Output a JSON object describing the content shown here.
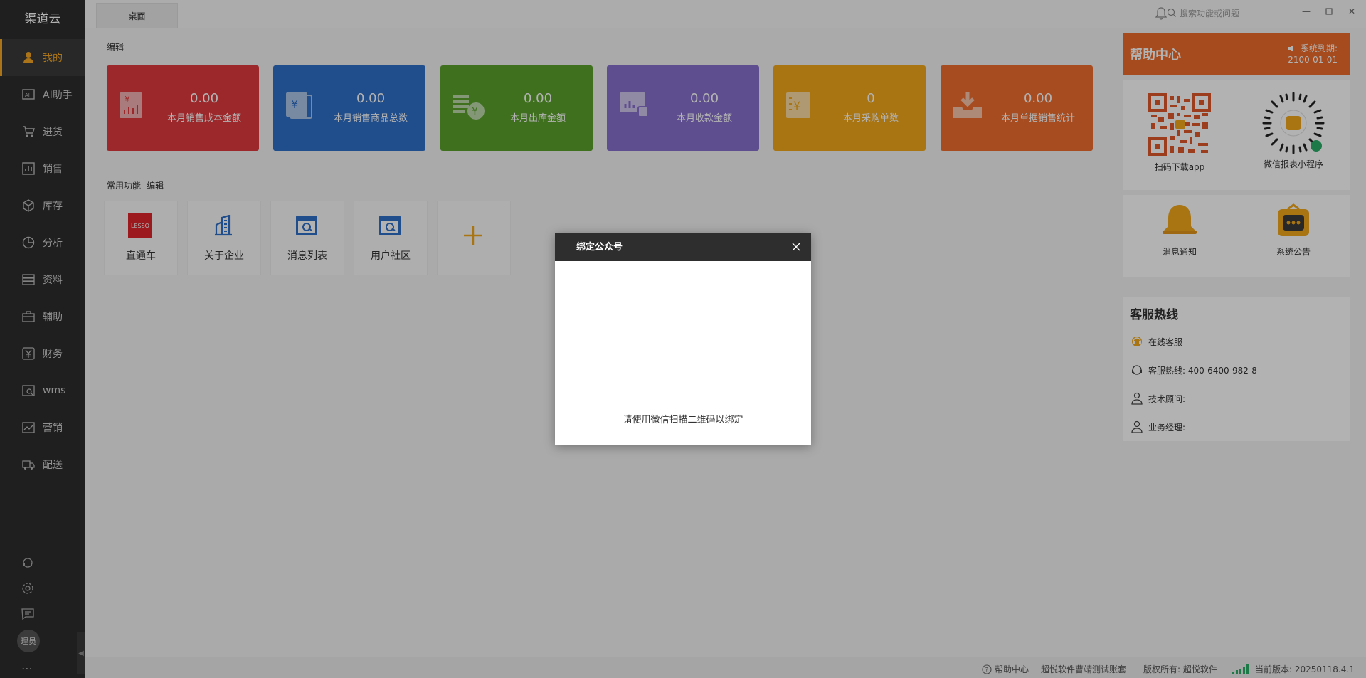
{
  "sidebar": {
    "brand": "渠道云",
    "items": [
      {
        "label": "我的",
        "icon": "user-icon"
      },
      {
        "label": "AI助手",
        "icon": "ai-icon"
      },
      {
        "label": "进货",
        "icon": "cart-icon"
      },
      {
        "label": "销售",
        "icon": "bar-chart-icon"
      },
      {
        "label": "库存",
        "icon": "box-icon"
      },
      {
        "label": "分析",
        "icon": "pie-chart-icon"
      },
      {
        "label": "资料",
        "icon": "database-icon"
      },
      {
        "label": "辅助",
        "icon": "toolbox-icon"
      },
      {
        "label": "财务",
        "icon": "yuan-icon"
      },
      {
        "label": "wms",
        "icon": "warehouse-icon"
      },
      {
        "label": "营销",
        "icon": "trend-icon"
      },
      {
        "label": "配送",
        "icon": "truck-icon"
      }
    ],
    "avatar_label": "理员",
    "more": "⋯"
  },
  "topbar": {
    "tab_label": "桌面",
    "search_placeholder": "搜索功能或问题"
  },
  "main": {
    "edit_label": "编辑",
    "stats": [
      {
        "value": "0.00",
        "label": "本月销售成本金额",
        "color": "#e03a3e"
      },
      {
        "value": "0.00",
        "label": "本月销售商品总数",
        "color": "#2f6fc7"
      },
      {
        "value": "0.00",
        "label": "本月出库金额",
        "color": "#5aa12b"
      },
      {
        "value": "0.00",
        "label": "本月收款金额",
        "color": "#8770cf"
      },
      {
        "value": "0",
        "label": "本月采购单数",
        "color": "#f2a81b"
      },
      {
        "value": "0.00",
        "label": "本月单据销售统计",
        "color": "#ee6e2e"
      }
    ],
    "common_title": "常用功能- 编辑",
    "quick": [
      {
        "label": "直通车",
        "badge": "LESSO"
      },
      {
        "label": "关于企业"
      },
      {
        "label": "消息列表"
      },
      {
        "label": "用户社区"
      },
      {
        "label": ""
      }
    ]
  },
  "right": {
    "help_title": "帮助中心",
    "expire_label": "系统到期:",
    "expire_date": "2100-01-01",
    "qr_app_label": "扫码下载app",
    "qr_mini_label": "微信报表小程序",
    "notify_label": "消息通知",
    "announce_label": "系统公告",
    "hotline_title": "客服热线",
    "online_service": "在线客服",
    "hotline_label": "客服热线: 400-6400-982-8",
    "tech_label": "技术顾问:",
    "biz_label": "业务经理:"
  },
  "status": {
    "help": "帮助中心",
    "account": "超悦软件曹靖测试账套",
    "copyright": "版权所有: 超悦软件",
    "version": "当前版本: 20250118.4.1"
  },
  "modal": {
    "title": "绑定公众号",
    "message": "请使用微信扫描二维码以绑定"
  }
}
